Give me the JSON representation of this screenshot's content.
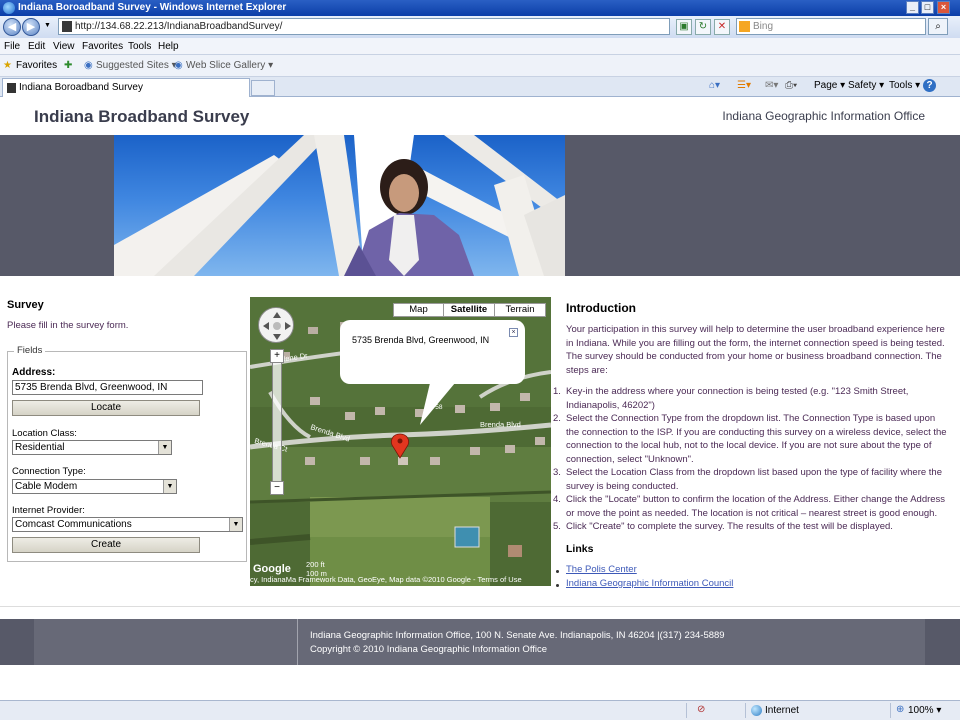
{
  "window": {
    "title": "Indiana Boroadband Survey - Windows Internet Explorer",
    "min": "_",
    "max": "□",
    "close": "×"
  },
  "address": {
    "url": "http://134.68.22.213/IndianaBroadbandSurvey/",
    "search_placeholder": "Bing"
  },
  "menu": [
    "File",
    "Edit",
    "View",
    "Favorites",
    "Tools",
    "Help"
  ],
  "favorites": {
    "label": "Favorites",
    "suggested": "Suggested Sites ▾",
    "webslice": "Web Slice Gallery ▾"
  },
  "tab": {
    "label": "Indiana Boroadband Survey"
  },
  "command_bar": {
    "page": "Page ▾",
    "safety": "Safety ▾",
    "tools": "Tools ▾",
    "help": "?"
  },
  "site": {
    "title": "Indiana Broadband Survey",
    "subtitle": "Indiana Geographic Information Office"
  },
  "survey": {
    "heading": "Survey",
    "instruction": "Please fill in the survey form.",
    "legend": "Fields",
    "address_label": "Address:",
    "address_value": "5735 Brenda Blvd, Greenwood, IN",
    "locate_button": "Locate",
    "location_class_label": "Location Class:",
    "location_class_value": "Residential",
    "connection_type_label": "Connection Type:",
    "connection_type_value": "Cable Modem",
    "provider_label": "Internet Provider:",
    "provider_value": "Comcast Communications",
    "create_button": "Create"
  },
  "map": {
    "types": [
      "Map",
      "Satellite",
      "Terrain"
    ],
    "active_type": "Satellite",
    "info_text": "5735 Brenda Blvd, Greenwood, IN",
    "streets": [
      "Darlene Dr",
      "Brenda Blvd",
      "Brenda Blvd",
      "Brenda Ct",
      "5758"
    ],
    "scale": [
      "200 ft",
      "100 m"
    ],
    "attribution": "cy, IndianaMa Framework Data, GeoEye, Map data ©2010 Google - Terms of Use",
    "logo": "Google"
  },
  "intro": {
    "heading": "Introduction",
    "paragraph": "Your participation in this survey will help to determine the user broadband experience here in Indiana. While you are filling out the form, the internet connection speed is being tested. The survey should be conducted from your home or business broadband connection. The steps are:",
    "steps": [
      "Key-in the address where your connection is being tested (e.g. \"123 Smith Street, Indianapolis, 46202\")",
      "Select the Connection Type from the dropdown list. The Connection Type is based upon the connection to the ISP. If you are conducting this survey on a wireless device, select the connection to the local hub, not to the local device. If you are not sure about the type of connection, select \"Unknown\".",
      "Select the Location Class from the dropdown list based upon the type of facility where the survey is being conducted.",
      "Click the \"Locate\" button to confirm the location of the Address. Either change the Address or move the point as needed. The location is not critical – nearest street is good enough.",
      "Click \"Create\" to complete the survey. The results of the test will be displayed."
    ],
    "links_heading": "Links",
    "links": [
      "The Polis Center",
      "Indiana Geographic Information Council"
    ]
  },
  "footer": {
    "line1": "Indiana Geographic Information Office, 100 N. Senate Ave. Indianapolis, IN 46204 |(317) 234-5889",
    "line2": "Copyright © 2010 Indiana Geographic Information Office"
  },
  "status": {
    "zone": "Internet",
    "zoom": "100% ▾"
  }
}
